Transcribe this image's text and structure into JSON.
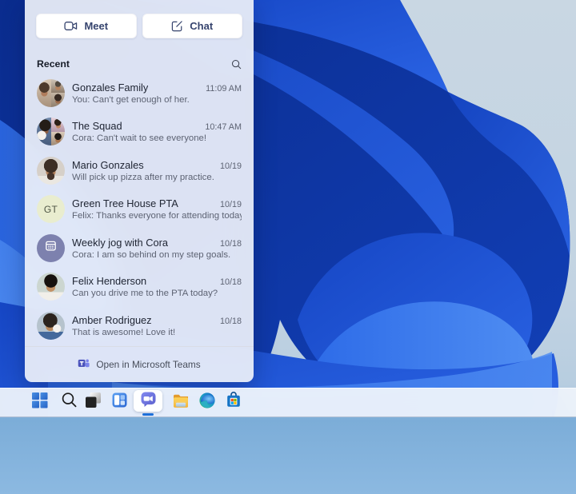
{
  "colors": {
    "accent_blue": "#1e6fd8",
    "panel_bg": "#edf0f8",
    "taskbar_bg": "#f0f4fa",
    "wallpaper_sky_top": "#c9d7e3",
    "wallpaper_sky_bottom": "#7fb0da",
    "bloom_dark": "#0d309a",
    "bloom_royal": "#1b4ed3",
    "bloom_bright": "#2e6fe8",
    "bloom_light": "#5795f2",
    "teams_purple": "#4b53bc"
  },
  "panel": {
    "actions": {
      "meet": {
        "label": "Meet",
        "icon": "video-camera-icon"
      },
      "chat": {
        "label": "Chat",
        "icon": "compose-icon"
      }
    },
    "recent_label": "Recent",
    "search_icon": "search-icon",
    "conversations": [
      {
        "name": "Gonzales Family",
        "preview": "You: Can't get enough of her.",
        "time": "11:09 AM",
        "avatar": "photo-collage"
      },
      {
        "name": "The Squad",
        "preview": "Cora: Can't wait to see everyone!",
        "time": "10:47 AM",
        "avatar": "photo-collage"
      },
      {
        "name": "Mario Gonzales",
        "preview": "Will pick up pizza after my practice.",
        "time": "10/19",
        "avatar": "photo"
      },
      {
        "name": "Green Tree House PTA",
        "preview": "Felix: Thanks everyone for attending today.",
        "time": "10/19",
        "avatar": "initials",
        "avatar_text": "GT",
        "avatar_bg": "#e9edcf"
      },
      {
        "name": "Weekly jog with Cora",
        "preview": "Cora: I am so behind on my step goals.",
        "time": "10/18",
        "avatar": "calendar-icon",
        "avatar_bg": "#7d81ae"
      },
      {
        "name": "Felix Henderson",
        "preview": "Can you drive me to the PTA today?",
        "time": "10/18",
        "avatar": "photo"
      },
      {
        "name": "Amber Rodriguez",
        "preview": "That is awesome! Love it!",
        "time": "10/18",
        "avatar": "photo"
      }
    ],
    "footer": {
      "label": "Open in Microsoft Teams",
      "icon": "teams-logo-icon"
    }
  },
  "taskbar": {
    "items": [
      {
        "id": "start",
        "icon": "windows-start-icon",
        "active": false
      },
      {
        "id": "search",
        "icon": "search-icon",
        "active": false
      },
      {
        "id": "task-view",
        "icon": "task-view-icon",
        "active": false
      },
      {
        "id": "widgets",
        "icon": "widgets-icon",
        "active": false
      },
      {
        "id": "chat",
        "icon": "teams-chat-icon",
        "active": true
      },
      {
        "id": "file-explorer",
        "icon": "folder-icon",
        "active": false
      },
      {
        "id": "edge",
        "icon": "edge-browser-icon",
        "active": false
      },
      {
        "id": "store",
        "icon": "microsoft-store-icon",
        "active": false
      }
    ]
  }
}
